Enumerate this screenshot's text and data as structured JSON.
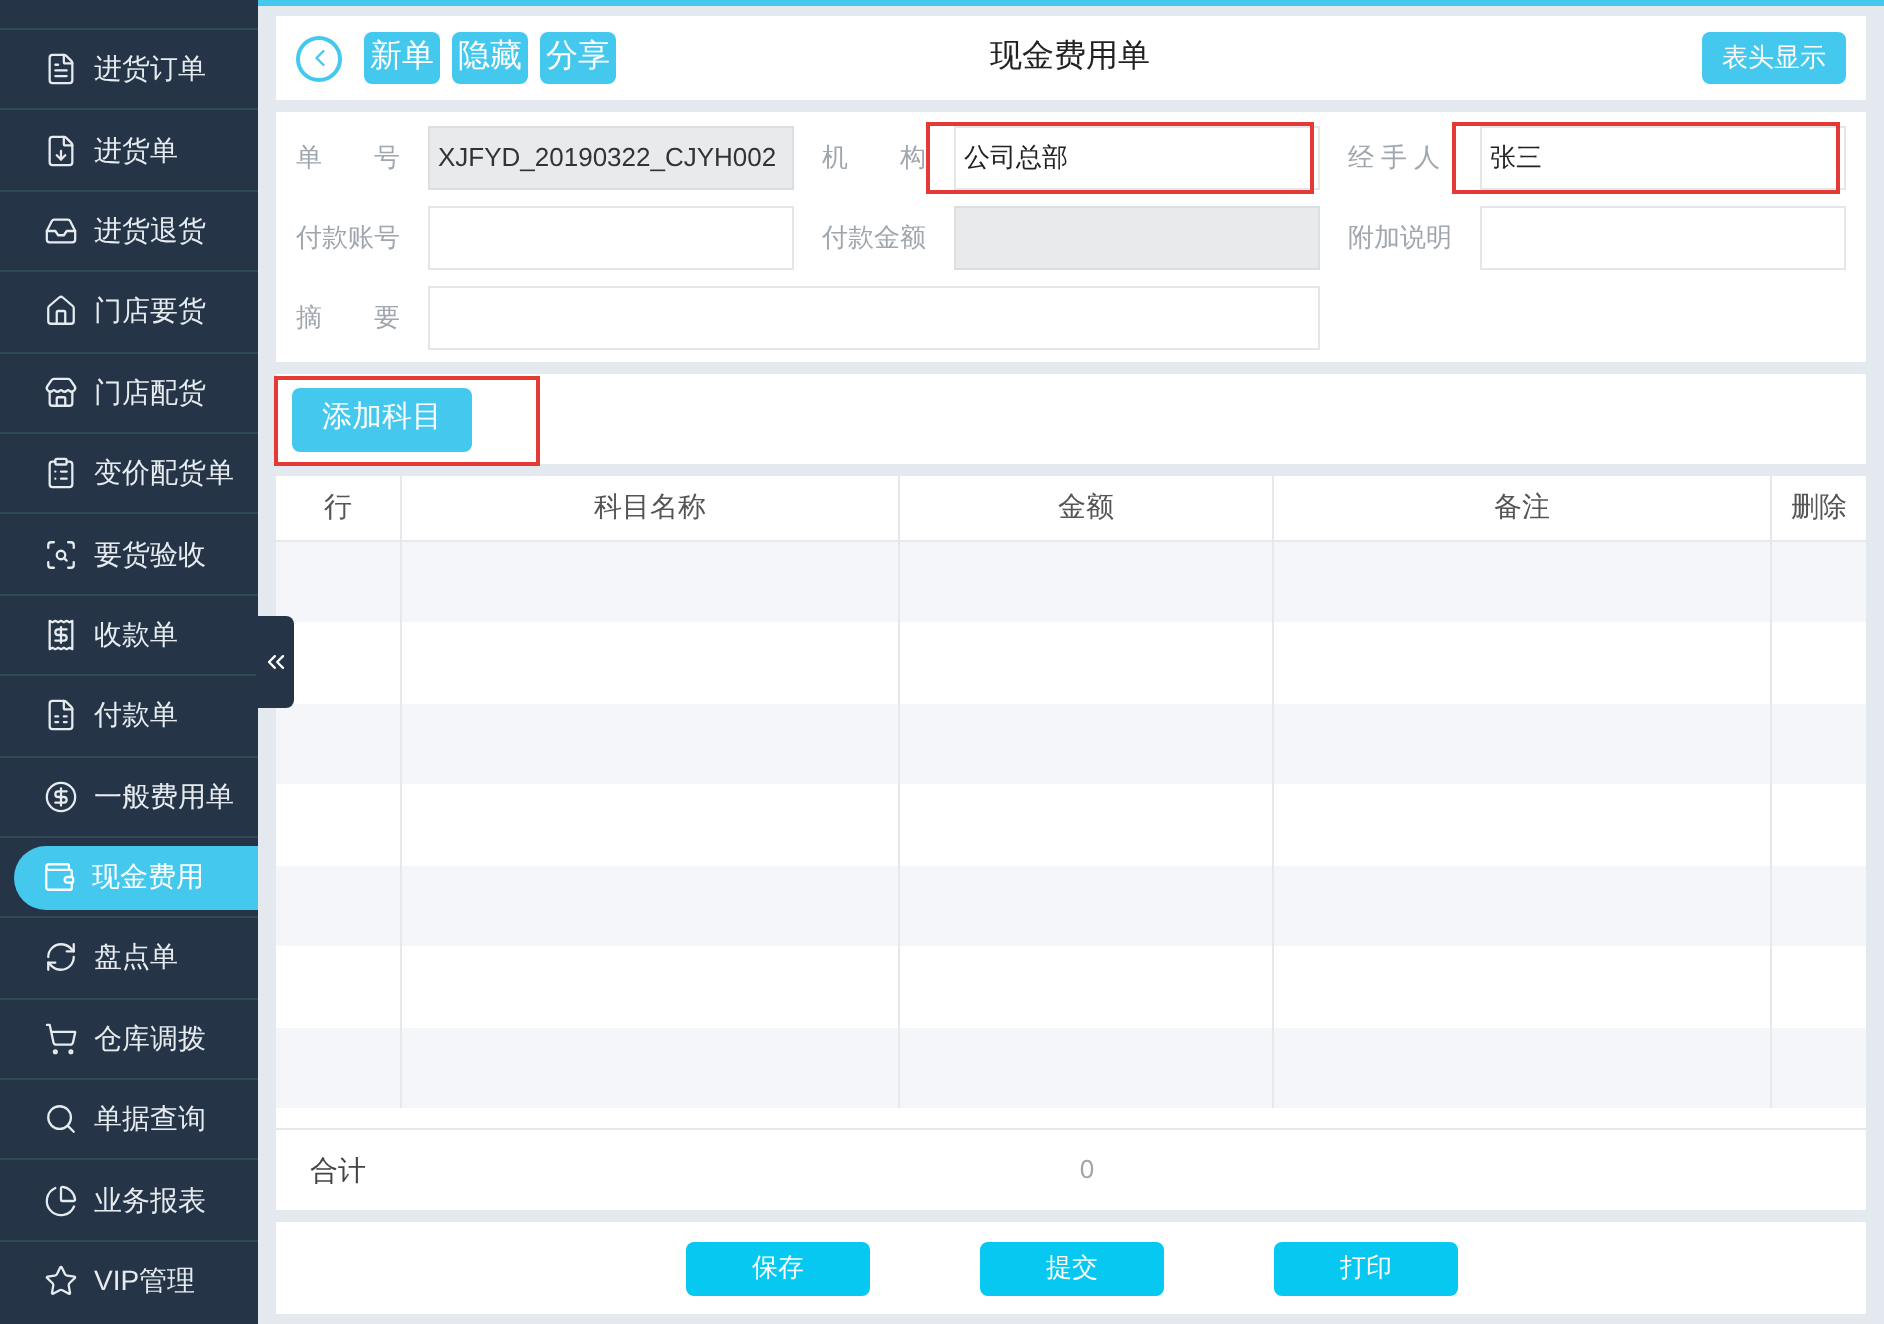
{
  "sidebar": {
    "items": [
      {
        "label": "进货订单",
        "selected": false
      },
      {
        "label": "进货单",
        "selected": false
      },
      {
        "label": "进货退货",
        "selected": false
      },
      {
        "label": "门店要货",
        "selected": false
      },
      {
        "label": "门店配货",
        "selected": false
      },
      {
        "label": "变价配货单",
        "selected": false
      },
      {
        "label": "要货验收",
        "selected": false
      },
      {
        "label": "收款单",
        "selected": false
      },
      {
        "label": "付款单",
        "selected": false
      },
      {
        "label": "一般费用单",
        "selected": false
      },
      {
        "label": "现金费用",
        "selected": true
      },
      {
        "label": "盘点单",
        "selected": false
      },
      {
        "label": "仓库调拨",
        "selected": false
      },
      {
        "label": "单据查询",
        "selected": false
      },
      {
        "label": "业务报表",
        "selected": false
      },
      {
        "label": "VIP管理",
        "selected": false
      }
    ]
  },
  "header": {
    "title": "现金费用单",
    "actions": [
      "新单",
      "隐藏",
      "分享"
    ],
    "toggle": "表头显示"
  },
  "form": {
    "fields": [
      {
        "label": "单　　号",
        "value": "XJFYD_20190322_CJYH002",
        "readonly": true
      },
      {
        "label": "机　　构",
        "value": "公司总部",
        "highlighted": true
      },
      {
        "label": "经 手 人",
        "value": "张三",
        "highlighted": true
      },
      {
        "label": "付款账号"
      },
      {
        "label": "付款金额",
        "readonly": true
      },
      {
        "label": "附加说明"
      },
      {
        "label": "摘　　要"
      }
    ]
  },
  "add_button": {
    "label": "添加科目",
    "highlighted": true
  },
  "table": {
    "columns": [
      "行",
      "科目名称",
      "金额",
      "备注",
      "删除"
    ]
  },
  "totals": {
    "label": "合计",
    "amount": "0"
  },
  "footer_buttons": [
    "保存",
    "提交",
    "打印"
  ]
}
